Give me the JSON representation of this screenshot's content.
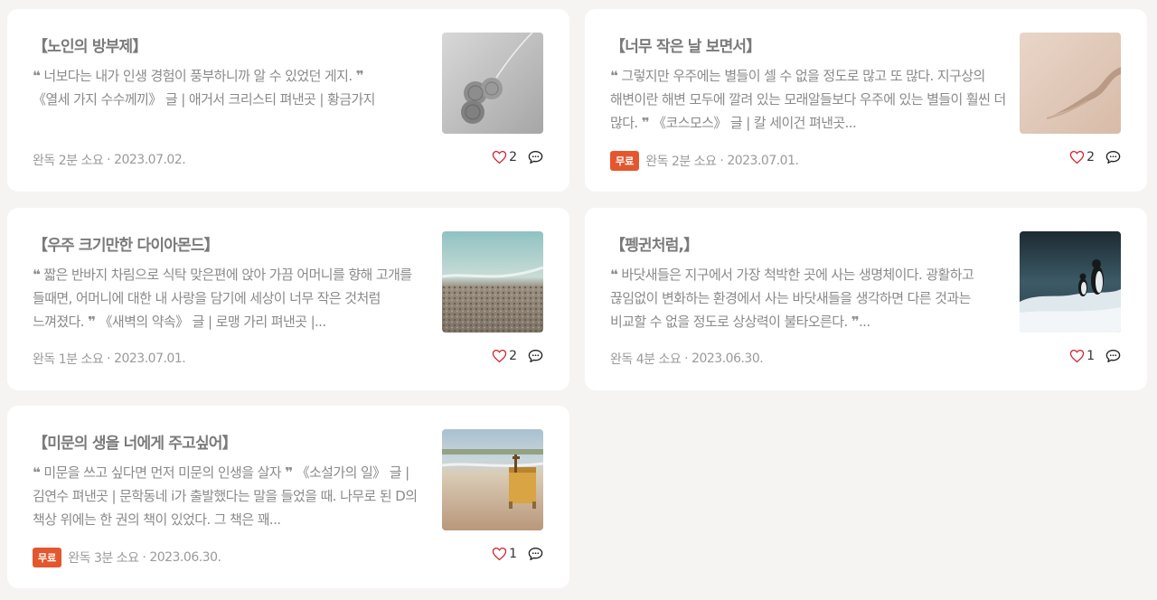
{
  "cards": [
    {
      "title": "【노인의 방부제】",
      "excerpt": "너보다는 내가 인생 경험이 풍부하니까 알 수 있었던 게지.",
      "source": "《열세 가지 수수께끼》 글 | 애거서 크리스티 펴낸곳 | 황금가지",
      "read_time": "완독 2분 소요",
      "date": "2023.07.02.",
      "badge": "",
      "likes": "2",
      "thumbnail": "yarn-balls-image",
      "opens_quote": "❝",
      "closes_quote": "❞"
    },
    {
      "title": "【너무 작은 날 보면서】",
      "excerpt": "그렇지만 우주에는 별들이 셀 수 없을 정도로 많고 또 많다. 지구상의 해변이란 해변 모두에 깔려 있는 모래알들보다 우주에 있는 별들이 훨씬 더 많다.",
      "source": "《코스모스》 글 | 칼 세이건 펴낸곳...",
      "read_time": "완독 2분 소요",
      "date": "2023.07.01.",
      "badge": "무료",
      "likes": "2",
      "thumbnail": "sand-dune-image",
      "opens_quote": "❝",
      "closes_quote": "❞"
    },
    {
      "title": "【우주 크기만한 다이아몬드】",
      "excerpt": "짧은 반바지 차림으로 식탁 맞은편에 앉아 가끔 어머니를 향해 고개를 들때면, 어머니에 대한 내 사랑을 담기에 세상이 너무 작은 것처럼 느껴졌다.",
      "source": "《새벽의 약속》 글 | 로맹 가리 펴낸곳 |...",
      "read_time": "완독 1분 소요",
      "date": "2023.07.01.",
      "badge": "",
      "likes": "2",
      "thumbnail": "pebble-beach-image",
      "opens_quote": "❝",
      "closes_quote": "❞"
    },
    {
      "title": "【펭귄처럼,】",
      "excerpt": "바닷새들은 지구에서 가장 척박한 곳에 사는 생명체이다. 광활하고 끊임없이 변화하는 환경에서 사는 바닷새들을 생각하면 다른 것과는 비교할 수 없을 정도로 상상력이 불타오른다.",
      "source": "...",
      "read_time": "완독 4분 소요",
      "date": "2023.06.30.",
      "badge": "",
      "likes": "1",
      "thumbnail": "penguins-image",
      "opens_quote": "❝",
      "closes_quote": "❞"
    },
    {
      "title": "【미문의 생을 너에게 주고싶어】",
      "excerpt": "미문을 쓰고 싶다면 먼저 미문의 인생을 살자",
      "source": "《소설가의 일》 글 | 김연수 펴낸곳 | 문학동네 i가 출발했다는 말을 들었을 때. 나무로 된 D의 책상 위에는 한 권의 책이 있었다. 그 책은 꽤...",
      "read_time": "완독 3분 소요",
      "date": "2023.06.30.",
      "badge": "무료",
      "likes": "1",
      "thumbnail": "beach-bench-image",
      "opens_quote": "❝",
      "closes_quote": "❞"
    }
  ],
  "meta_separator": "·",
  "colors": {
    "badge": "#e4572e",
    "like_icon": "#d0212d"
  }
}
